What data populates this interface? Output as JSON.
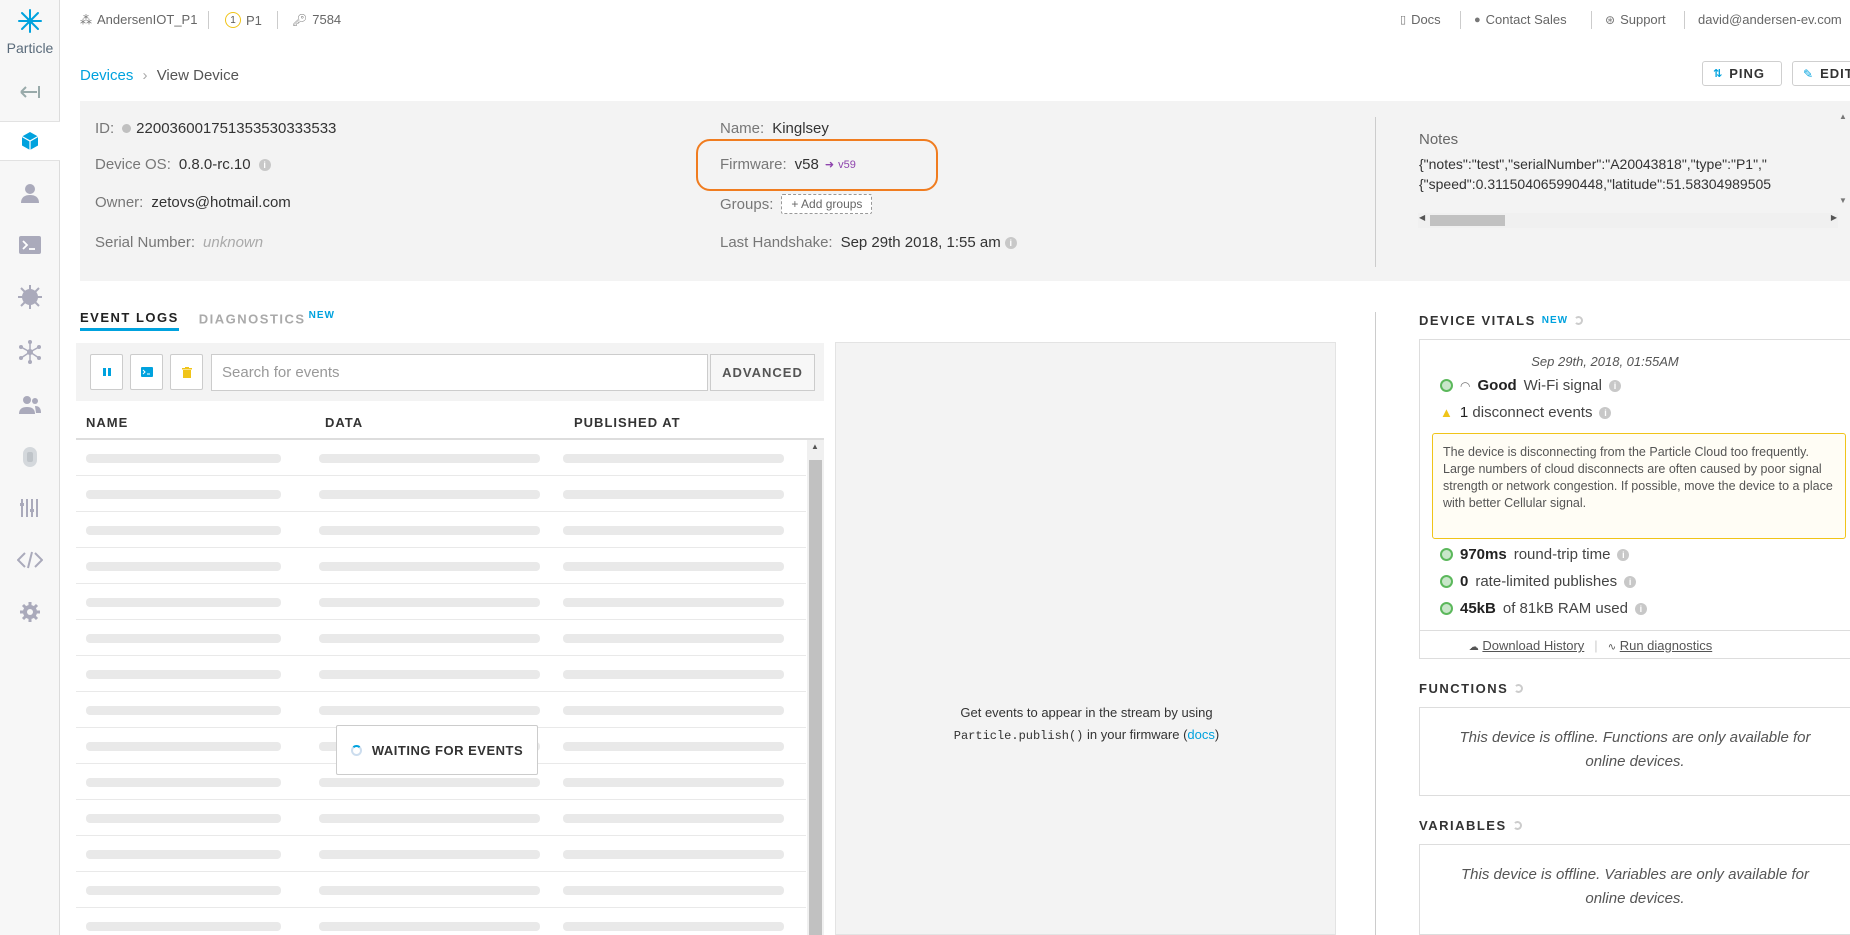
{
  "sidebar": {
    "logo_text": "Particle",
    "items": [
      "back-icon",
      "devices-icon",
      "user-icon",
      "console-icon",
      "integrations-icon",
      "mesh-icon",
      "team-icon",
      "sims-icon",
      "billing-icon",
      "code-icon",
      "settings-icon"
    ]
  },
  "topbar": {
    "product": "AndersenIOT_P1",
    "platform_badge": "1",
    "platform": "P1",
    "product_id": "7584",
    "docs": "Docs",
    "contact_sales": "Contact Sales",
    "support": "Support",
    "user_email": "david@andersen-ev.com"
  },
  "breadcrumb": {
    "root": "Devices",
    "separator": "›",
    "current": "View Device"
  },
  "actions": {
    "ping": "PING",
    "edit": "EDIT"
  },
  "device": {
    "id_label": "ID:",
    "id": "220036001751353530333533",
    "os_label": "Device OS:",
    "os": "0.8.0-rc.10",
    "owner_label": "Owner:",
    "owner": "zetovs@hotmail.com",
    "serial_label": "Serial Number:",
    "serial": "unknown",
    "name_label": "Name:",
    "name": "Kinglsey",
    "firmware_label": "Firmware:",
    "firmware": "v58",
    "firmware_target": "v59",
    "groups_label": "Groups:",
    "add_groups": "+ Add groups",
    "handshake_label": "Last Handshake:",
    "handshake": "Sep 29th 2018, 1:55 am"
  },
  "notes": {
    "title": "Notes",
    "line1": "{\"notes\":\"test\",\"serialNumber\":\"A20043818\",\"type\":\"P1\",\"",
    "line2": "{\"speed\":0.311504065990448,\"latitude\":51.58304989505"
  },
  "tabs": {
    "event_logs": "EVENT LOGS",
    "diagnostics": "DIAGNOSTICS",
    "new": "NEW"
  },
  "events": {
    "search_placeholder": "Search for events",
    "advanced": "ADVANCED",
    "columns": [
      "NAME",
      "DATA",
      "PUBLISHED AT"
    ],
    "waiting": "WAITING FOR EVENTS",
    "hint_line1": "Get events to appear in the stream by using",
    "hint_code": "Particle.publish()",
    "hint_mid": " in your firmware (",
    "hint_link": "docs",
    "hint_end": ")"
  },
  "vitals": {
    "title": "DEVICE VITALS",
    "new": "NEW",
    "timestamp": "Sep 29th, 2018, 01:55AM",
    "signal_strength": "Good",
    "signal_text": "Wi-Fi signal",
    "disconnects_count": "1",
    "disconnects_text": "disconnect events",
    "warning": "The device is disconnecting from the Particle Cloud too frequently. Large numbers of cloud disconnects are often caused by poor signal strength or network congestion. If possible, move the device to a place with better Cellular signal.",
    "rtt_value": "970ms",
    "rtt_text": "round-trip time",
    "rate_limited_value": "0",
    "rate_limited_text": "rate-limited publishes",
    "ram_value": "45kB",
    "ram_text": "of 81kB RAM used",
    "download_history": "Download History",
    "run_diagnostics": "Run diagnostics",
    "accent": "#00a2de",
    "warn_color": "#f0c419"
  },
  "functions": {
    "title": "FUNCTIONS",
    "offline": "This device is offline. Functions are only available for online devices."
  },
  "variables": {
    "title": "VARIABLES",
    "offline": "This device is offline. Variables are only available for online devices."
  },
  "colors": {
    "accent": "#00a2de",
    "highlight": "#f07c1f",
    "firmware_target": "#8e44ad"
  }
}
